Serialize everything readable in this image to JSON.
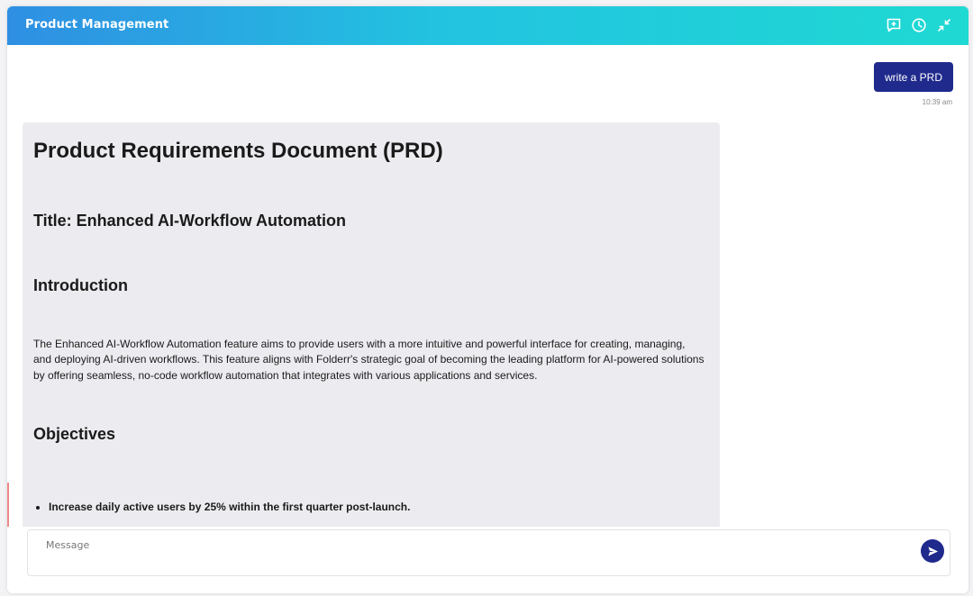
{
  "header": {
    "title": "Product Management",
    "icons": [
      "new-chat-icon",
      "history-icon",
      "collapse-icon"
    ]
  },
  "conversation": {
    "user_message": {
      "text": "write a PRD",
      "time": "10:39 am"
    },
    "assistant_document": {
      "heading": "Product Requirements Document (PRD)",
      "title_line": "Title: Enhanced AI-Workflow Automation",
      "intro_heading": "Introduction",
      "intro_text": "The Enhanced AI-Workflow Automation feature aims to provide users with a more intuitive and powerful interface for creating, managing, and deploying AI-driven workflows. This feature aligns with Folderr's strategic goal of becoming the leading platform for AI-powered solutions by offering seamless, no-code workflow automation that integrates with various applications and services.",
      "objectives_heading": "Objectives",
      "objectives": [
        "Increase daily active users by 25% within the first quarter post-launch."
      ]
    }
  },
  "composer": {
    "placeholder": "Message",
    "value": ""
  },
  "colors": {
    "header_gradient_start": "#2f8fe3",
    "header_gradient_end": "#1fd9d3",
    "user_bubble": "#1f2a8c",
    "document_bg": "#ececf0",
    "send_button": "#1f2a8c"
  }
}
